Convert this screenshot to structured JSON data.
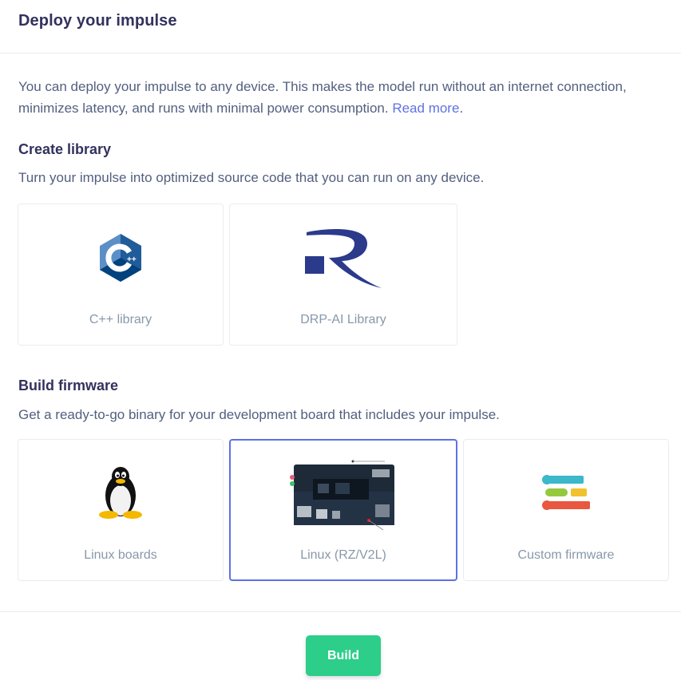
{
  "header": {
    "title": "Deploy your impulse"
  },
  "intro": {
    "text": "You can deploy your impulse to any device. This makes the model run without an internet connection, minimizes latency, and runs with minimal power consumption. ",
    "link": "Read more",
    "after": "."
  },
  "library": {
    "title": "Create library",
    "description": "Turn your impulse into optimized source code that you can run on any device.",
    "cards": [
      {
        "label": "C++ library",
        "icon": "cpp-logo-icon"
      },
      {
        "label": "DRP-AI Library",
        "icon": "renesas-r-logo-icon"
      }
    ]
  },
  "firmware": {
    "title": "Build firmware",
    "description": "Get a ready-to-go binary for your development board that includes your impulse.",
    "cards": [
      {
        "label": "Linux boards",
        "icon": "tux-penguin-icon"
      },
      {
        "label": "Linux (RZ/V2L)",
        "icon": "rz-v2l-board-image",
        "selected": true
      },
      {
        "label": "Custom firmware",
        "icon": "custom-firmware-icon"
      }
    ]
  },
  "footer": {
    "build_label": "Build"
  },
  "colors": {
    "accent": "#5e72e4",
    "build": "#2dce89",
    "heading": "#32325d"
  }
}
